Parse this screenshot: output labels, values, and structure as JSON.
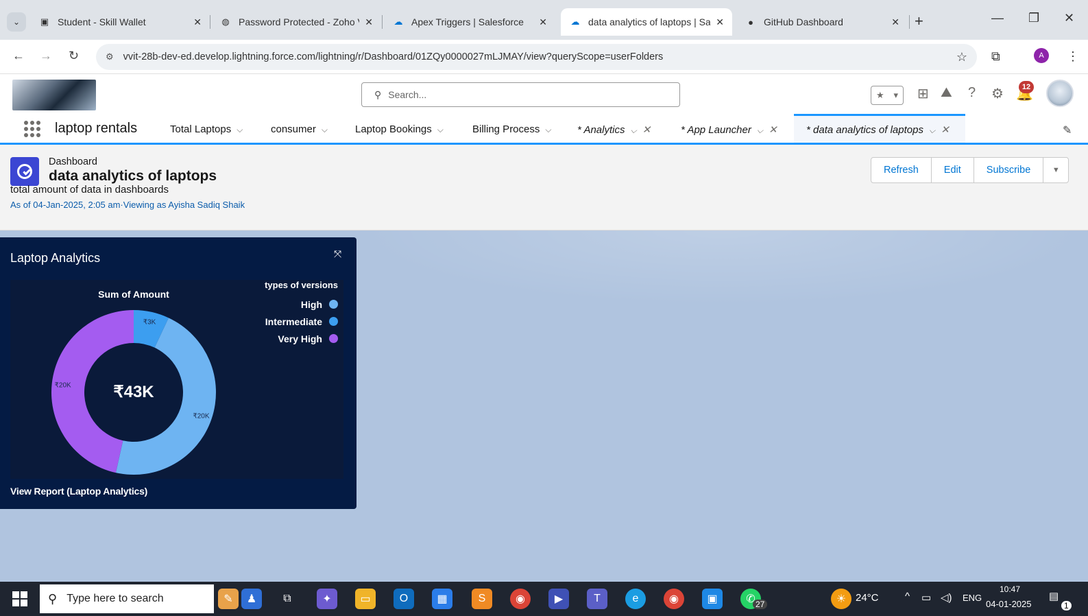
{
  "browser": {
    "tabs": [
      {
        "title": "Student - Skill Wallet",
        "favicon": "skillwallet-icon"
      },
      {
        "title": "Password Protected - Zoho V",
        "favicon": "globe-icon"
      },
      {
        "title": "Apex Triggers | Salesforce",
        "favicon": "salesforce-cloud-icon"
      },
      {
        "title": "data analytics of laptops | Sa",
        "favicon": "salesforce-cloud-icon",
        "active": true
      },
      {
        "title": "GitHub Dashboard",
        "favicon": "github-icon"
      }
    ],
    "url": "vvit-28b-dev-ed.develop.lightning.force.com/lightning/r/Dashboard/01ZQy0000027mLJMAY/view?queryScope=userFolders",
    "profile_initial": "A"
  },
  "sf_header": {
    "search_placeholder": "Search...",
    "notification_count": "12"
  },
  "app_nav": {
    "app_name": "laptop rentals",
    "items": [
      {
        "label": "Total Laptops"
      },
      {
        "label": "consumer"
      },
      {
        "label": "Laptop Bookings"
      },
      {
        "label": "Billing Process"
      },
      {
        "label": "* Analytics"
      },
      {
        "label": "* App Launcher"
      },
      {
        "label": "* data analytics of laptops"
      }
    ]
  },
  "dashboard": {
    "kicker": "Dashboard",
    "title": "data analytics of laptops",
    "description": "total amount of data in dashboards",
    "meta": "As of 04-Jan-2025, 2:05 am·Viewing as Ayisha Sadiq Shaik",
    "buttons": {
      "refresh": "Refresh",
      "edit": "Edit",
      "subscribe": "Subscribe"
    }
  },
  "widget": {
    "title": "Laptop Analytics",
    "view_report": "View Report (Laptop Analytics)"
  },
  "chart_data": {
    "type": "pie",
    "title": "Sum of Amount",
    "center_label": "₹43K",
    "legend_title": "types of versions",
    "legend_placement": "top-right",
    "slices": [
      {
        "name": "Intermediate",
        "value": 3,
        "label": "₹3K",
        "color": "#3c9ef0"
      },
      {
        "name": "High",
        "value": 20,
        "label": "₹20K",
        "color": "#6eb4f2"
      },
      {
        "name": "Very High",
        "value": 20,
        "label": "₹20K",
        "color": "#a45cf0"
      }
    ],
    "legend": [
      {
        "name": "High",
        "color": "#6eb4f2"
      },
      {
        "name": "Intermediate",
        "color": "#3c9ef0"
      },
      {
        "name": "Very High",
        "color": "#a45cf0"
      }
    ]
  },
  "taskbar": {
    "search_placeholder": "Type here to search",
    "weather": "24°C",
    "language": "ENG",
    "time": "10:47",
    "date": "04-01-2025",
    "whatsapp_badge": "27",
    "notification_badge": "1"
  },
  "colors": {
    "sf_blue": "#0176d3",
    "active_tab_border": "#1b96ff",
    "widget_bg": "#041b44",
    "canvas_bg": "#b0c4df",
    "dashboard_icon": "#3b46d3"
  }
}
